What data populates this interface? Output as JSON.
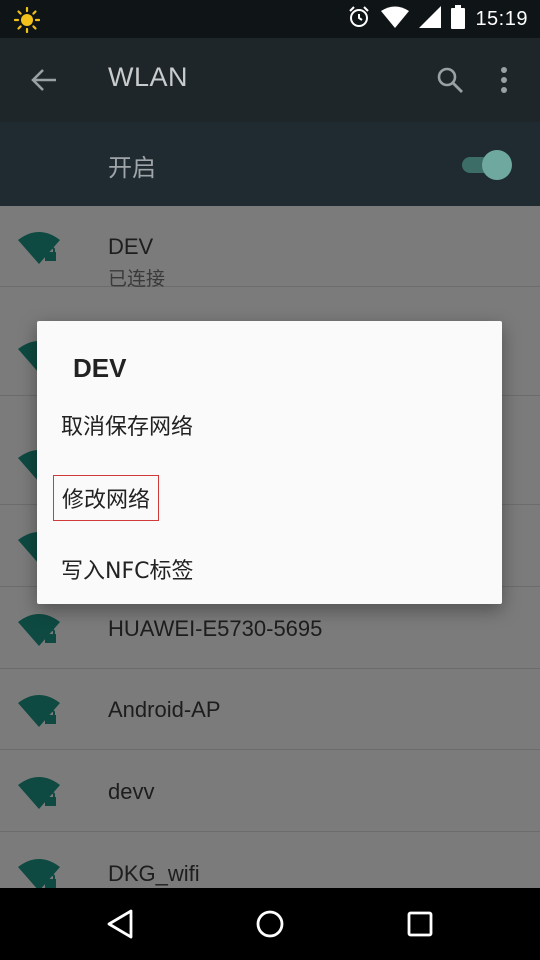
{
  "status_bar": {
    "time": "15:19",
    "icons": [
      "brightness-icon",
      "alarm-icon",
      "wifi-signal-icon",
      "cell-signal-icon",
      "battery-icon"
    ]
  },
  "app_bar": {
    "title": "WLAN",
    "back_icon": "arrow-back-icon",
    "search_icon": "search-icon",
    "more_icon": "more-vert-icon"
  },
  "switch_bar": {
    "label": "开启",
    "state": "on"
  },
  "networks": [
    {
      "name": "DEV",
      "status": "已连接"
    },
    {
      "name": "HUAWEI-E5730-5695",
      "status": ""
    },
    {
      "name": "Android-AP",
      "status": ""
    },
    {
      "name": "devv",
      "status": ""
    },
    {
      "name": "DKG_wifi",
      "status": ""
    }
  ],
  "dialog": {
    "title": "DEV",
    "items": [
      "取消保存网络",
      "修改网络",
      "写入NFC标签"
    ]
  },
  "nav_bar": {
    "icons": [
      "nav-back-icon",
      "nav-home-icon",
      "nav-recents-icon"
    ]
  },
  "colors": {
    "accent": "#6fa89f",
    "wifi_icon": "#0e4a42",
    "highlight_border": "#d03a3a"
  }
}
